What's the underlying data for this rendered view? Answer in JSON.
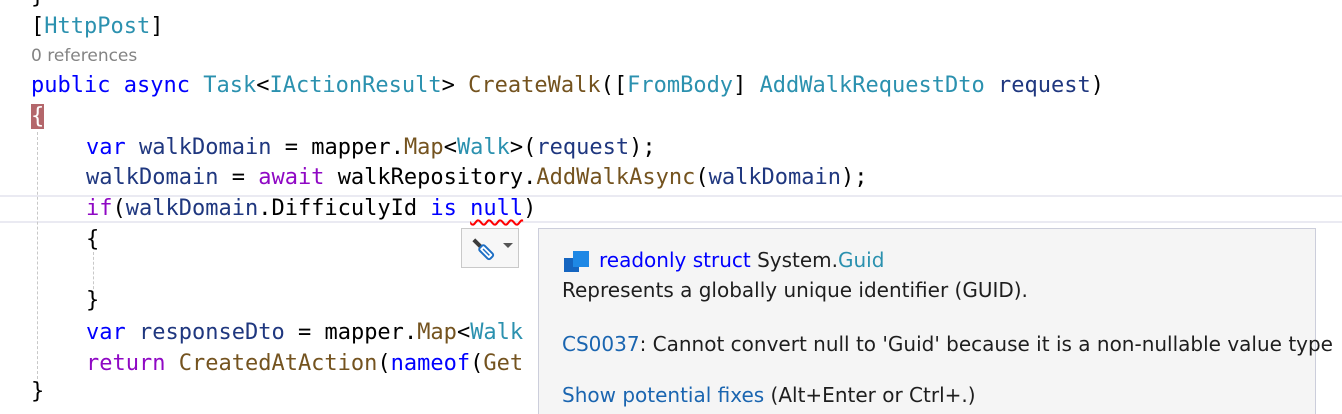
{
  "code": {
    "prev_brace": "}",
    "attribute": {
      "open": "[",
      "name": "HttpPost",
      "close": "]"
    },
    "codelens": "0 references",
    "signature": {
      "public": "public",
      "async": "async",
      "task": "Task",
      "lt": "<",
      "iaction": "IActionResult",
      "gt": ">",
      "method": "CreateWalk",
      "paren_bracket": "([",
      "frombody": "FromBody",
      "bracket_close": "]",
      "dto": "AddWalkRequestDto",
      "param": "request",
      "paren_close": ")"
    },
    "open_brace": "{",
    "line1": {
      "var": "var",
      "name": "walkDomain",
      "eq": " = ",
      "mapper": "mapper",
      "dot": ".",
      "map": "Map",
      "lt": "<",
      "walk": "Walk",
      "gt_paren": ">(",
      "arg": "request",
      "end": ");"
    },
    "line2": {
      "name": "walkDomain",
      "eq": " = ",
      "await": "await",
      "repo": "walkRepository",
      "dot": ".",
      "method": "AddWalkAsync",
      "open": "(",
      "arg": "walkDomain",
      "end": ");"
    },
    "line3": {
      "if": "if",
      "open": "(",
      "name": "walkDomain",
      "member": ".DifficulyId ",
      "is": "is",
      "null": "null",
      "close": ")"
    },
    "inner_open": "{",
    "inner_close": "}",
    "line4": {
      "var": "var",
      "name": "responseDto",
      "eq": " = ",
      "mapper": "mapper",
      "dot": ".",
      "map": "Map",
      "lt": "<",
      "walk_partial": "Walk"
    },
    "line5": {
      "return": "return",
      "method": "CreatedAtAction",
      "open": "(",
      "nameof": "nameof",
      "open2": "(",
      "get_partial": "Get"
    },
    "close_brace": "}"
  },
  "quickinfo": {
    "icon": "struct-icon",
    "readonly": "readonly",
    "struct": "struct",
    "namespace": "System.",
    "type": "Guid",
    "description": "Represents a globally unique identifier (GUID).",
    "error_code": "CS0037",
    "error_message": ": Cannot convert null to 'Guid' because it is a non-nullable value type",
    "fix_link": "Show potential fixes",
    "fix_shortcut": " (Alt+Enter or Ctrl+.)"
  },
  "lightbulb": {
    "icon": "screwdriver-icon",
    "dropdown_icon": "chevron-down-icon"
  },
  "colors": {
    "keyword": "#0000ff",
    "type": "#2b91af",
    "method": "#74531f",
    "variable": "#1f377f",
    "control": "#8f08c4",
    "brace_highlight": "#b4676b",
    "error_squiggle": "#ff0000"
  }
}
